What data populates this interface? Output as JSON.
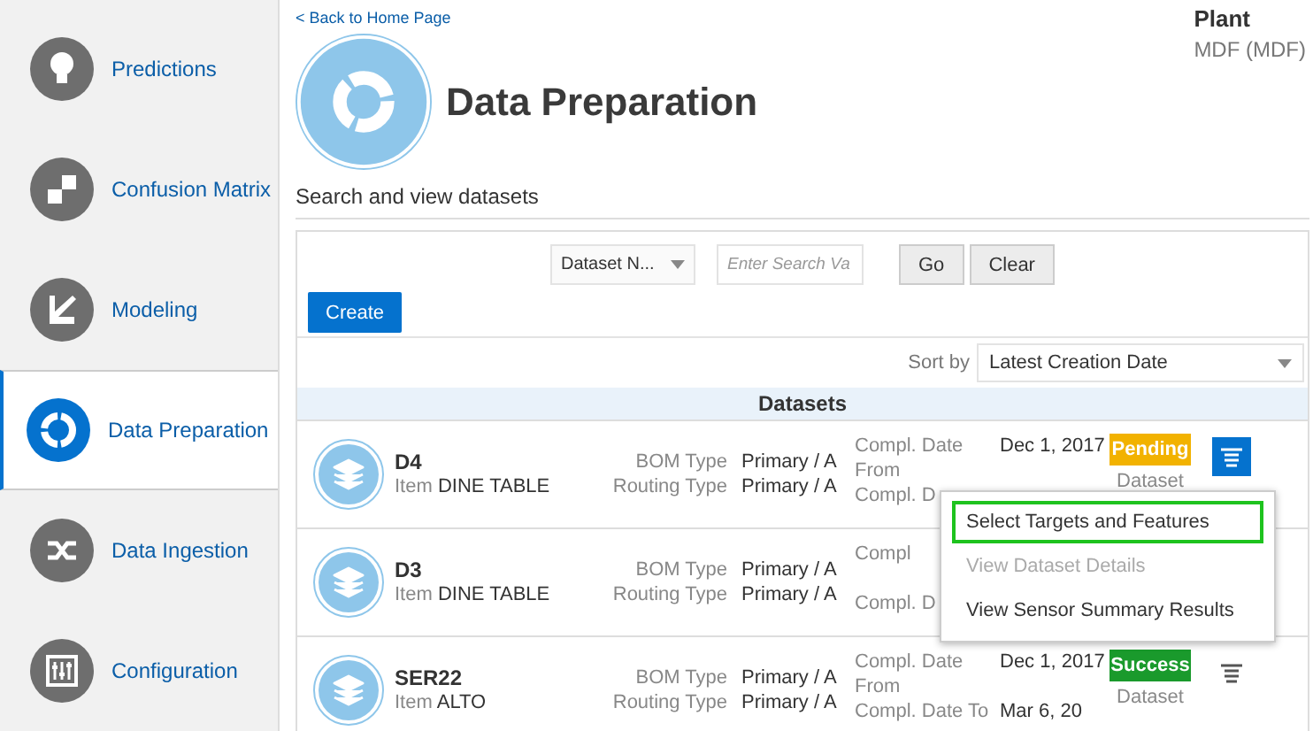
{
  "sidebar": {
    "items": [
      {
        "label": "Predictions",
        "selected": false
      },
      {
        "label": "Confusion Matrix",
        "selected": false
      },
      {
        "label": "Modeling",
        "selected": false
      },
      {
        "label": "Data Preparation",
        "selected": true
      },
      {
        "label": "Data Ingestion",
        "selected": false
      },
      {
        "label": "Configuration",
        "selected": false
      }
    ]
  },
  "back_link": "< Back to Home Page",
  "plant": {
    "label": "Plant",
    "value": "MDF (MDF)"
  },
  "title": "Data Preparation",
  "subtitle": "Search and view datasets",
  "search": {
    "field_select": "Dataset N...",
    "placeholder": "Enter Search Va",
    "buttons": [
      "Go",
      "Clear"
    ]
  },
  "create_button": "Create",
  "sort": {
    "label": "Sort by",
    "value": "Latest Creation Date"
  },
  "list_title": "Datasets",
  "rows": [
    {
      "name": "D4",
      "item_label": "Item",
      "item": "DINE TABLE",
      "bom_label": "BOM Type",
      "bom": "Primary / A",
      "routing_label": "Routing Type",
      "routing": "Primary / A",
      "date_from_label": "Compl. Date From",
      "date_from": "Dec 1, 2017",
      "date_to_label": "Compl. D",
      "status": {
        "label": "Pending",
        "color": "#f2b200"
      },
      "status_caption": "Dataset",
      "menu_open": true
    },
    {
      "name": "D3",
      "item_label": "Item",
      "item": "DINE TABLE",
      "bom_label": "BOM Type",
      "bom": "Primary / A",
      "routing_label": "Routing Type",
      "routing": "Primary / A",
      "date_from_label": "Compl",
      "date_to_label": "Compl. D"
    },
    {
      "name": "SER22",
      "item_label": "Item",
      "item": "ALTO",
      "bom_label": "BOM Type",
      "bom": "Primary / A",
      "routing_label": "Routing Type",
      "routing": "Primary / A",
      "date_from_label": "Compl. Date From",
      "date_from": "Dec 1, 2017",
      "date_to_label": "Compl. Date To",
      "date_to": "Mar 6, 20",
      "status": {
        "label": "Success",
        "color": "#1a9a2c"
      },
      "status_caption": "Dataset",
      "menu_open": false
    }
  ],
  "menu": [
    {
      "label": "Select Targets and Features",
      "disabled": false,
      "selected": true
    },
    {
      "label": "View Dataset Details",
      "disabled": true,
      "selected": false
    },
    {
      "label": "View Sensor Summary Results",
      "disabled": false,
      "selected": false
    }
  ]
}
